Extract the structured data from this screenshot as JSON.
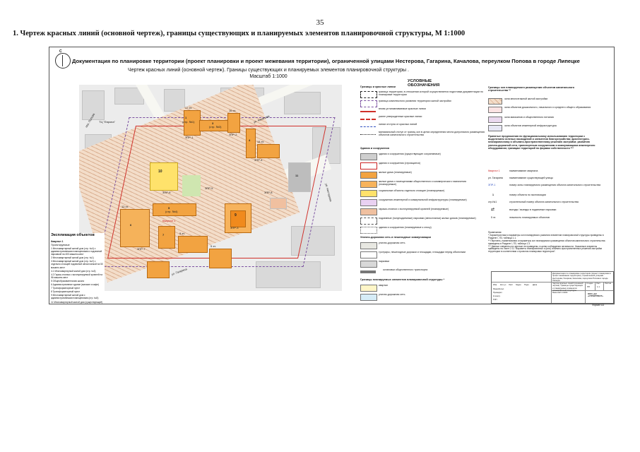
{
  "page_number": "35",
  "heading": "1. Чертеж красных линий (основной чертеж), границы существующих и планируемых элементов планировочной структуры, М 1:1000",
  "sheet": {
    "main_title": "Документация по планировке территории (проект планировки и проект межевания территории), ограниченной улицами  Нестерова, Гагарина, Качалова, переулком  Попова в городе Липецке",
    "subtitle": "Чертеж красных линий (основной чертеж). Границы существующих и планируемых элементов планировочной структуры .",
    "scale": "Масштаб 1:1000",
    "north": "С"
  },
  "map_labels": {
    "street_popova": "пер. Попова",
    "street_kachalova": "ул. Качалова",
    "street_gagarina": "ул. Гагарина",
    "street_nesterova": "ул. Нестерова",
    "quarter_1": "Квартал 1",
    "tc": "ТЦ \"Европа\"",
    "p1": "1",
    "p1_sub": "(стр. №1)",
    "p3": "3",
    "p3_sub": "(стр. №3)",
    "p4": "4",
    "p5": "5",
    "p5_sub": "(стр. №4)",
    "p6": "6",
    "p7": "7",
    "p9": "9",
    "p10": "10",
    "p11": "11",
    "z1": "ЗПР-1",
    "z2": "ЗПР-2",
    "z3": "ЗПР-3",
    "z4": "ЗПР-4",
    "z5": "ЗПР-5",
    "z6": "ЗПР-6",
    "z7": "ЗПР-7",
    "z8": "ЗПР-8",
    "fl5": "5 эт.",
    "fl9": "9 эт.",
    "fl12": "12 эт.",
    "fl14": "14 эт.",
    "fl16": "16 эт.",
    "fl17": "17 эт."
  },
  "explication": {
    "title": "Экспликация объектов",
    "quarter": "Квартал 1",
    "planned": "Проектируемые",
    "items": [
      "1    Многоквартирный жилой дом (стр. №4) с административными помещениями и подземной парковкой на 400 машино-мест",
      "2    Многоквартирный жилой дом (стр. №1)",
      "3    Многоквартирный жилой дом (стр. №2) с отдельно стоящей подземной автостоянкой на 50 машино-мест",
      "4.1  Многоквартирный жилой дом (стр. №3)",
      "4.2  Гараж-стоянка с эксплуатируемой кровлей на 56 машино-мест",
      "5    Общеобразовательная школа",
      "6    Административное здание (магазин и кафе)",
      "7    Трансформаторный пункт",
      "8    Трансформаторный пункт",
      "9    Многоквартирный жилой дом с административными помещениями (стр. №5)",
      "11   Многоквартирный жилой дом (существующий)"
    ]
  },
  "legend": {
    "title": "УСЛОВНЫЕ ОБОЗНАЧЕНИЯ",
    "sections": {
      "borders": "Границы и красные линии",
      "buildings": "Здания и сооружения",
      "roads": "Улично-дорожная сеть и пешеходные коммуникации",
      "structure": "Границы планируемых элементов планировочной структуры *",
      "zones": "Границы зон планируемого размещения объектов капитального строительства **",
      "proposals": "Принятые предложения по функциональному использованию территории с выделением зеленых насаждений и элементов благоустройства; архитектурно-планировочному и объемно-пространственному решению застройки; развитию улично-дорожной сети, транспортным сооружениям и коммуникациям инженерного оборудования; границам территорий по формам собственности ***"
    },
    "border_items": [
      "граница территории, в отношении которой осуществляется подготовка документации по планировке территории",
      "граница комплексного развития территории жилой застройки",
      "вновь устанавливаемые красные линии",
      "ранее утвержденные красные линии",
      "линии отступа от красных линий",
      "минимальный отступ от границ зон в целях определения места допустимого размещения объектов капитального строительства"
    ],
    "building_items": [
      "здания и сооружения (существующие сохраняемые)",
      "здания и сооружения (строящиеся)",
      "жилые дома (планируемые)",
      "жилые дома с помещениями общественного и коммерческого назначения (планируемые)",
      "социальные объекты отдельно стоящие (планируемые)",
      "сооружения инженерной и коммунальной инфраструктуры (планируемые)",
      "гаражи-стоянки с эксплуатируемой кровлей (планируемые)",
      "подземные (полуподземные) парковки (автостоянки) жилых домов (планируемые)",
      "здания и сооружения (планируемые к сносу)"
    ],
    "road_items": [
      "улично-дорожная сеть",
      "тротуары, пешеходные дорожки и площадки, площадки перед объектами",
      "парковки",
      "остановки общественного транспорта"
    ],
    "structure_items": [
      "квартал",
      "улично-дорожная сеть"
    ],
    "zone_items": [
      "зона многоэтажной жилой застройки",
      "зона объектов дошкольного, начального и среднего общего образования",
      "зона магазинов и общественного питания",
      "зона объектов инженерной инфраструктуры"
    ],
    "symbols": [
      {
        "sym": "Квартал 1",
        "text": "наименование квартала"
      },
      {
        "sym": "ул. Гагарина",
        "text": "наименование существующей улицы"
      },
      {
        "sym": "ЗПР-1",
        "text": "номер зоны планируемого размещения объекта капитального строительства"
      },
      {
        "sym": "1",
        "text": "номер объекта по экспликации"
      },
      {
        "sym": "стр.№1",
        "text": "строительный номер объекта капитального строительства"
      },
      {
        "sym": "⇄",
        "text": "въезды / выезды в подземные парковки"
      },
      {
        "sym": "5 эт.",
        "text": "этажность планируемых объектов"
      }
    ]
  },
  "notes": {
    "title": "Примечания:",
    "lines": [
      "* Характеристики и параметры зон планируемого развития элементов планировочной структуры приведены в Разделе I, П3, таблица 1.1.",
      "** Перечень, наименования и параметры зон планируемого размещения объектов капитального строительства приведены в Разделе I, П3, таблица 1.3.",
      "*** Данные элементы на чертеже не приведены, в целях соблюдения читаемости. Указанные элементы приведены на Листе 2.11 \"Варианты планировочных и (или) объемно-пространственных решений застройки территории в соответствии с проектом планировки территории\"."
    ]
  },
  "stamp": {
    "doc_text": "Документация по планировке территории (проект планировки и проект межевания территории), ограниченной улицами Нестерова, Гагарина, Качалова, переулком Попова в городе Липецке",
    "drawing_text": "Чертеж красных линий (основной чертеж). Границы существующих и планируемых элементов планировочной структуры. Масштаб 1:1000",
    "stage_hdr": "Стадия",
    "sheet_hdr": "Лист",
    "sheets_hdr": "Листов",
    "stage": "ПП",
    "sheet": "1.1",
    "org": "ООО «СЗ «СТРОЙТРЕСТ»",
    "format": "Формат А3",
    "cols": [
      "Изм.",
      "Кол.уч",
      "Лист",
      "№док.",
      "Подп.",
      "Дата"
    ],
    "roles": [
      "Разработал",
      "Проверил",
      "Н.контр.",
      "ГИП"
    ]
  }
}
